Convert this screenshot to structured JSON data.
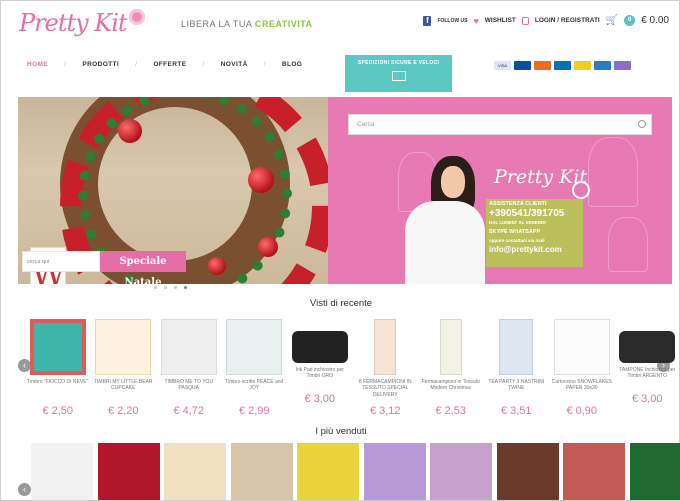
{
  "header": {
    "logo": "Pretty Kit",
    "tagline_prefix": "LIBERA LA TUA ",
    "tagline_highlight": "CREATIVITA",
    "follow_us": "FOLLOW US",
    "wishlist": "WISHLIST",
    "login": "LOGIN / REGISTRATI",
    "cart_count": "0",
    "cart_total": "€ 0.00"
  },
  "nav": {
    "items": [
      "HOME",
      "PRODOTTI",
      "OFFERTE",
      "NOVITÀ",
      "BLOG"
    ],
    "separator": "/"
  },
  "shipping": {
    "label": "SPEDIZIONI SICURE E VELOCI"
  },
  "payments": [
    "VISA",
    "MC",
    "MAESTRO",
    "PAYPAL",
    "POSTEPAY",
    "CARTA",
    "AMEX"
  ],
  "payment_colors": [
    "#dfe5f3",
    "#0a4f9c",
    "#eb6d22",
    "#0c6eb4",
    "#f2cf1d",
    "#2c7bc4",
    "#8b6fc9"
  ],
  "hero": {
    "search_mini_placeholder": "cerca qui",
    "speciale_label": "Speciale Natale",
    "search_placeholder": "Cerca",
    "promo_logo": "Pretty Kit",
    "assistenza": "ASSISTENZA CLIENTI",
    "phone": "+390541/391705",
    "hours": "DAL LUNEDI' AL VENERDI'",
    "skype_whatsapp": "SKYPE   WHATSAPP",
    "email_label": "oppure contattaci via mail",
    "email": "info@prettykit.com"
  },
  "recent": {
    "title": "Visti di recente",
    "products": [
      {
        "name": "Timbro \"FIOCCO DI NEVE\"",
        "price": "€ 2,50"
      },
      {
        "name": "TIMBRI MY LITTLE BEAR CUPCAKE",
        "price": "€ 2,20"
      },
      {
        "name": "TIMBRO ME TO YOU PASQUA",
        "price": "€ 4,72"
      },
      {
        "name": "Timbro scritte PEACE and JOY",
        "price": "€ 2,99"
      },
      {
        "name": "Ink Pad inchiostro per Timbri ORO",
        "price": "€ 3,00"
      },
      {
        "name": "8 FERMACAMPIONI IN TESSUTO SPECIAL DELIVERY",
        "price": "€ 3,12"
      },
      {
        "name": "Fermacampioni in Tessuto Modern Christmas",
        "price": "€ 2,53"
      },
      {
        "name": "TEA PARTY 3 NASTRINI TWINE",
        "price": "€ 3,51"
      },
      {
        "name": "Cartoncino SNOWFLAKES PAPER 30x30",
        "price": "€ 0,90"
      },
      {
        "name": "TAMPONE Inchiostro per Timbri ARGENTO",
        "price": "€ 3,00"
      }
    ]
  },
  "best": {
    "title": "I più venduti",
    "colors": [
      "#f2f2f2",
      "#b3152a",
      "#efe0c0",
      "#d8c4a8",
      "#e9d23a",
      "#b79ad6",
      "#c8a0cc",
      "#6c3a2a",
      "#c25b55",
      "#1f6a2e"
    ]
  }
}
